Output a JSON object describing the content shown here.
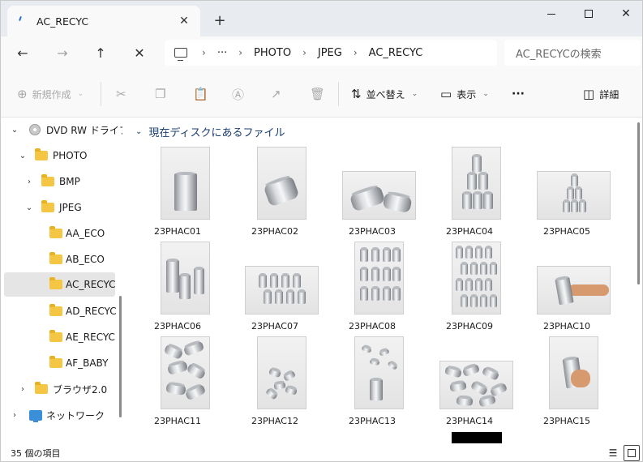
{
  "window": {
    "tab_title": "AC_RECYC",
    "tab_close": "✕",
    "new_tab": "+"
  },
  "nav": {
    "back": "←",
    "forward": "→",
    "up": "↑",
    "cancel": "✕",
    "breadcrumb_more": "···",
    "breadcrumb_sep": "›",
    "breadcrumbs": [
      "PHOTO",
      "JPEG",
      "AC_RECYC"
    ],
    "search_placeholder": "AC_RECYCの検索"
  },
  "toolbar": {
    "new_label": "新規作成",
    "sort_label": "並べ替え",
    "view_label": "表示",
    "more_label": "···",
    "details_label": "詳細"
  },
  "sidebar": {
    "items": [
      {
        "label": "DVD RW ドライブ",
        "icon": "disc-icon"
      },
      {
        "label": "PHOTO",
        "icon": "folder-icon"
      },
      {
        "label": "BMP",
        "icon": "folder-icon"
      },
      {
        "label": "JPEG",
        "icon": "folder-icon"
      },
      {
        "label": "AA_ECO",
        "icon": "folder-icon"
      },
      {
        "label": "AB_ECO",
        "icon": "folder-icon"
      },
      {
        "label": "AC_RECYC",
        "icon": "folder-icon",
        "selected": true
      },
      {
        "label": "AD_RECYC",
        "icon": "folder-icon"
      },
      {
        "label": "AE_RECYC",
        "icon": "folder-icon"
      },
      {
        "label": "AF_BABY",
        "icon": "folder-icon"
      },
      {
        "label": "ブラウザ2.0",
        "icon": "folder-icon"
      },
      {
        "label": "ネットワーク",
        "icon": "network-icon"
      }
    ]
  },
  "content": {
    "group_header": "現在ディスクにあるファイル",
    "files": [
      "23PHAC01",
      "23PHAC02",
      "23PHAC03",
      "23PHAC04",
      "23PHAC05",
      "23PHAC06",
      "23PHAC07",
      "23PHAC08",
      "23PHAC09",
      "23PHAC10",
      "23PHAC11",
      "23PHAC12",
      "23PHAC13",
      "23PHAC14",
      "23PHAC15"
    ]
  },
  "status": {
    "item_count": "35 個の項目"
  }
}
